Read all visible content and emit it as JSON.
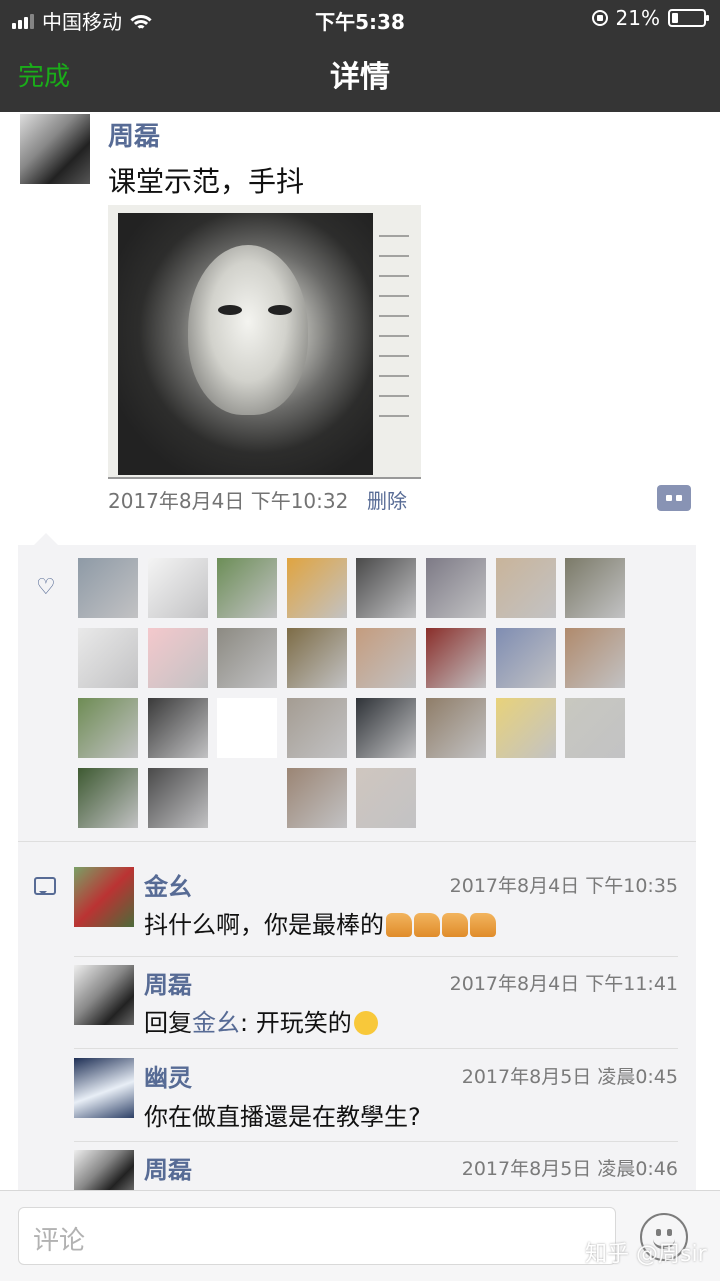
{
  "status_bar": {
    "carrier": "中国移动",
    "time": "下午5:38",
    "battery": "21%",
    "battery_level": 0.21
  },
  "nav": {
    "done": "完成",
    "title": "详情"
  },
  "post": {
    "author": "周磊",
    "text": "课堂示范，手抖",
    "time": "2017年8月4日 下午10:32",
    "delete": "删除"
  },
  "likes": {
    "avatar_colors": [
      [
        "#8e9aa6",
        "#f4f4f4",
        "#6c8e57",
        "#e0a440",
        "#4a4a4a",
        "#7d7a86",
        "#c9b49a",
        "#7b7a68"
      ],
      [
        "#e9e9e9",
        "#f4c8cc",
        "#8c8a82",
        "#7d6c46",
        "#c49c7e",
        "#8a2e2a",
        "#7f8db2",
        "#b08a6c"
      ],
      [
        "#6e8c54",
        "#3a3a3a",
        "#ffffff",
        "#a49c92",
        "#2f3338",
        "#8f7d68",
        "#e8d27a",
        "#c8c8c0"
      ],
      [
        "#3e5a32",
        "#4a4a4a",
        "#f3f3f5",
        "#9b8574",
        "#cfc6bf"
      ]
    ]
  },
  "comments": [
    {
      "name": "金幺",
      "time": "2017年8月4日 下午10:35",
      "text": "抖什么啊，你是最棒的",
      "emoji": "thumbs-up"
    },
    {
      "name": "周磊",
      "time": "2017年8月4日 下午11:41",
      "prefix": "回复",
      "reply_to": "金幺",
      "text": ": 开玩笑的",
      "emoji": "thinking"
    },
    {
      "name": "幽灵",
      "time": "2017年8月5日 凌晨0:45",
      "text": "你在做直播還是在教學生?"
    },
    {
      "name": "周磊",
      "time": "2017年8月5日 凌晨0:46",
      "text": ""
    }
  ],
  "input": {
    "placeholder": "评论"
  },
  "watermark": "知乎 @周sir"
}
